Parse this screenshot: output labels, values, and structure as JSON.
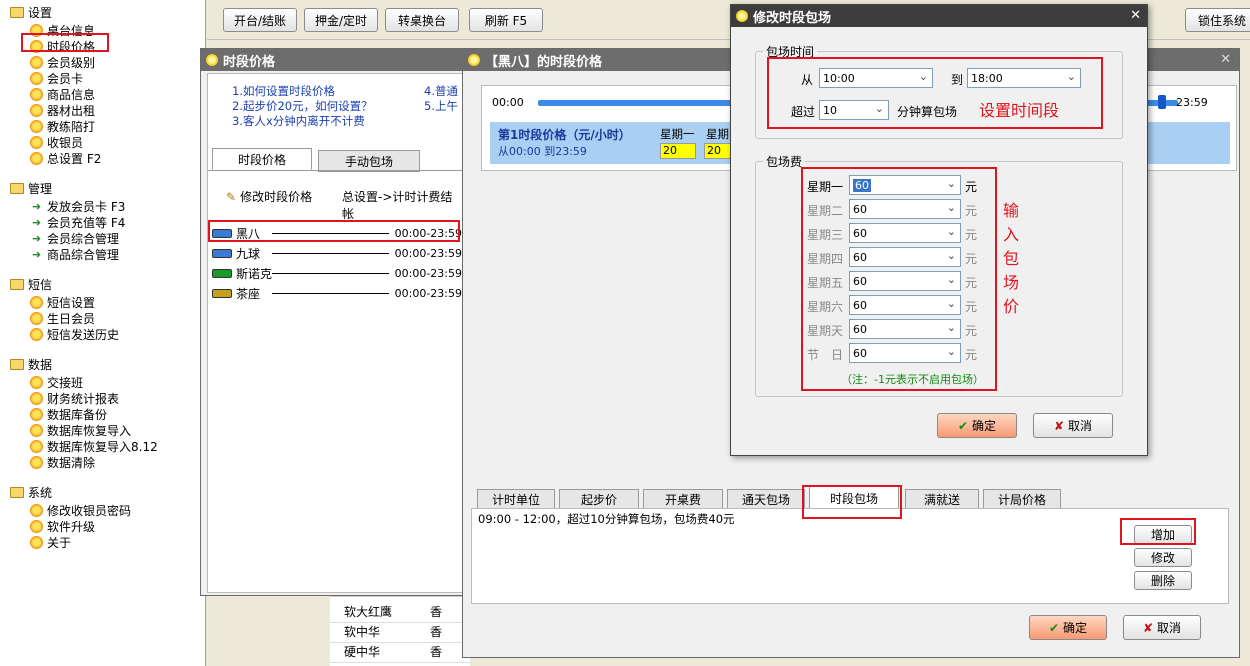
{
  "sidebar": {
    "sections": [
      {
        "label": "设置",
        "items": [
          "桌台信息",
          "时段价格",
          "会员级别",
          "会员卡",
          "商品信息",
          "器材出租",
          "教练陪打",
          "收银员",
          "总设置 F2"
        ]
      },
      {
        "label": "管理",
        "items": [
          "发放会员卡 F3",
          "会员充值等 F4",
          "会员综合管理",
          "商品综合管理"
        ]
      },
      {
        "label": "短信",
        "items": [
          "短信设置",
          "生日会员",
          "短信发送历史"
        ]
      },
      {
        "label": "数据",
        "items": [
          "交接班",
          "财务统计报表",
          "数据库备份",
          "数据库恢复导入",
          "数据库恢复导入8.12",
          "数据清除"
        ]
      },
      {
        "label": "系统",
        "items": [
          "修改收银员密码",
          "软件升级",
          "关于"
        ]
      }
    ]
  },
  "toolbar": {
    "open_checkout": "开台/结账",
    "deposit_timer": "押金/定时",
    "transfer": "转桌换台",
    "refresh": "刷新 F5",
    "lock": "锁住系统"
  },
  "price_window": {
    "title": "时段价格",
    "help_links": [
      "1.如何设置时段价格",
      "2.起步价20元，如何设置？",
      "3.客人x分钟内离开不计费"
    ],
    "help_links_right": [
      "4.普通",
      "5.上午"
    ],
    "tabs": [
      "时段价格",
      "手动包场"
    ],
    "edit_btn": "修改时段价格",
    "settings_link": "总设置->计时计费结帐",
    "tables": [
      {
        "name": "黑八",
        "time": "00:00-23:59"
      },
      {
        "name": "九球",
        "time": "00:00-23:59"
      },
      {
        "name": "斯诺克",
        "time": "00:00-23:59"
      },
      {
        "name": "茶座",
        "time": "00:00-23:59"
      }
    ]
  },
  "heiba_window": {
    "title": "【黑八】的时段价格",
    "slider_start": "00:00",
    "slider_end": "23:59",
    "period_title": "第1时段价格（元/小时）",
    "period_range": "从00:00 到23:59",
    "day_headers": [
      "星期一",
      "星期"
    ],
    "day_values": [
      "20",
      "20"
    ],
    "tabs": [
      "计时单位",
      "起步价",
      "开桌费",
      "通天包场",
      "时段包场",
      "满就送",
      "计局价格"
    ],
    "rule_text": "09:00 - 12:00，超过10分钟算包场，包场费40元",
    "add": "增加",
    "modify": "修改",
    "delete": "删除",
    "ok": "确定",
    "cancel": "取消"
  },
  "bg_list": {
    "rows": [
      [
        "软大红鹰",
        "香"
      ],
      [
        "软中华",
        "香"
      ],
      [
        "硬中华",
        "香"
      ]
    ]
  },
  "dialog": {
    "title": "修改时段包场",
    "time_group": "包场时间",
    "from_label": "从",
    "from_value": "10:00",
    "to_label": "到",
    "to_value": "18:00",
    "over_label": "超过",
    "over_value": "10",
    "over_suffix": "分钟算包场",
    "annot_time": "设置时间段",
    "fee_group": "包场费",
    "days": [
      {
        "label": "星期一",
        "value": "60"
      },
      {
        "label": "星期二",
        "value": "60"
      },
      {
        "label": "星期三",
        "value": "60"
      },
      {
        "label": "星期四",
        "value": "60"
      },
      {
        "label": "星期五",
        "value": "60"
      },
      {
        "label": "星期六",
        "value": "60"
      },
      {
        "label": "星期天",
        "value": "60"
      },
      {
        "label": "节　日",
        "value": "60"
      }
    ],
    "unit": "元",
    "note": "（注：-1元表示不启用包场）",
    "annot_fee": "输入包场价",
    "ok": "确定",
    "cancel": "取消"
  }
}
